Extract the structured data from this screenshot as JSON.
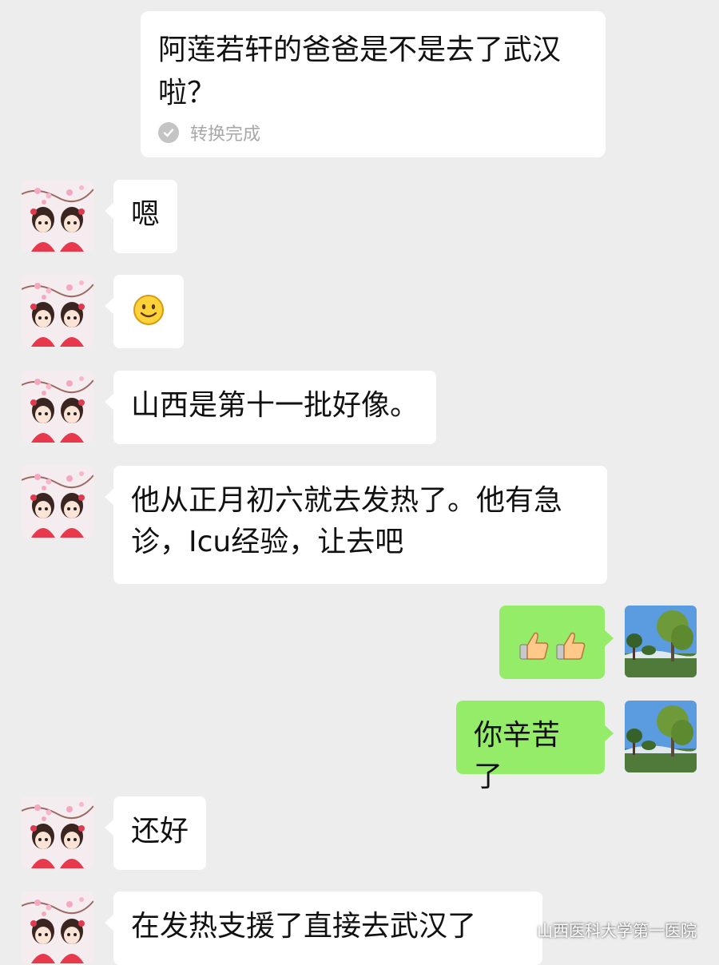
{
  "voice_message": {
    "text": "阿莲若轩的爸爸是不是去了武汉啦？",
    "status": "转换完成",
    "status_icon": "check-circle-icon"
  },
  "messages": [
    {
      "side": "in",
      "text": "嗯",
      "avatar": "twin-girls-avatar"
    },
    {
      "side": "in",
      "emoji": "smile-emoji",
      "avatar": "twin-girls-avatar"
    },
    {
      "side": "in",
      "text": "山西是第十一批好像。",
      "avatar": "twin-girls-avatar"
    },
    {
      "side": "in",
      "text": "他从正月初六就去发热了。他有急诊，Icu经验，让去吧",
      "avatar": "twin-girls-avatar"
    },
    {
      "side": "out",
      "emoji": "thumbs-up-emoji x2",
      "avatar": "tree-landscape-avatar"
    },
    {
      "side": "out",
      "text": "你辛苦了",
      "avatar": "tree-landscape-avatar"
    },
    {
      "side": "in",
      "text": "还好",
      "avatar": "twin-girls-avatar"
    },
    {
      "side": "in",
      "text": "在发热支援了直接去武汉了",
      "avatar": "twin-girls-avatar"
    }
  ],
  "watermark": {
    "text": "山西医科大学第一医院",
    "icon": "wechat-logo-icon"
  },
  "colors": {
    "background": "#ededed",
    "incoming_bubble": "#ffffff",
    "outgoing_bubble": "#95ec69"
  }
}
